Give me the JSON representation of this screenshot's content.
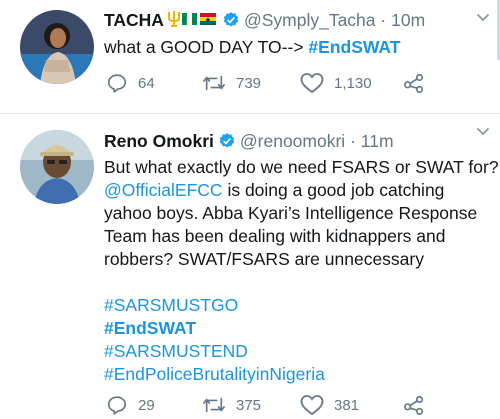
{
  "tweets": [
    {
      "name": "TACHA",
      "handle": "@Symply_Tacha",
      "sep": "·",
      "time": "10m",
      "text_plain": "what a GOOD DAY TO-->",
      "text_tag": "#EndSWAT",
      "replies": "64",
      "retweets": "739",
      "likes": "1,130"
    },
    {
      "name": "Reno Omokri",
      "handle": "@renoomokri",
      "sep": "·",
      "time": "11m",
      "line1": "But what exactly do we need FSARS or SWAT for?",
      "mention": "@OfficialEFCC",
      "line2_rest": " is doing a good job catching",
      "line3": "yahoo boys. Abba Kyari’s Intelligence Response",
      "line4": "Team has been dealing with kidnappers and",
      "line5": "robbers? SWAT/FSARS are unnecessary",
      "hashtags": [
        "#SARSMUSTGO",
        "#EndSWAT",
        "#SARSMUSTEND",
        "#EndPoliceBrutalityinNigeria"
      ],
      "replies": "29",
      "retweets": "375",
      "likes": "381"
    }
  ],
  "colors": {
    "link": "#1b95e0",
    "meta": "#657786",
    "verified": "#1da1f2"
  },
  "icons": [
    "reply-icon",
    "retweet-icon",
    "like-icon",
    "share-icon",
    "verified-icon",
    "caret-down-icon",
    "trident-emoji",
    "nigeria-flag-emoji",
    "ghana-flag-emoji"
  ]
}
